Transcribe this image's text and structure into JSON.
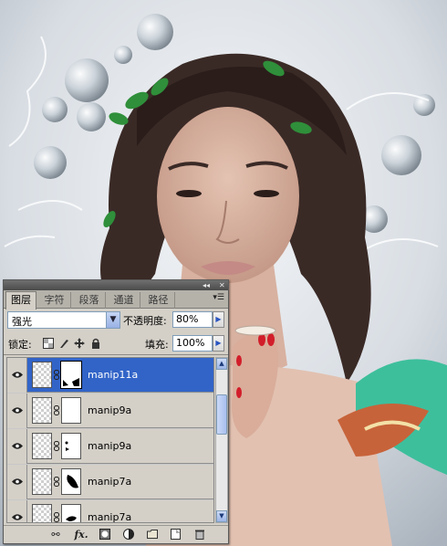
{
  "panel": {
    "title_controls": {
      "collapse": "◂◂",
      "close": "✕"
    },
    "tabs": [
      {
        "label": "图层",
        "active": true
      },
      {
        "label": "字符",
        "active": false
      },
      {
        "label": "段落",
        "active": false
      },
      {
        "label": "通道",
        "active": false
      },
      {
        "label": "路径",
        "active": false
      }
    ],
    "menu_icon": "panel-menu-icon",
    "blend_mode": "强光",
    "opacity_label": "不透明度:",
    "opacity_value": "80%",
    "lock_label": "锁定:",
    "fill_label": "填充:",
    "fill_value": "100%",
    "layers": [
      {
        "name": "manip11a",
        "visible": true,
        "selected": true
      },
      {
        "name": "manip9a",
        "visible": true,
        "selected": false
      },
      {
        "name": "manip9a",
        "visible": true,
        "selected": false
      },
      {
        "name": "manip7a",
        "visible": true,
        "selected": false
      },
      {
        "name": "manip7a",
        "visible": true,
        "selected": false
      }
    ],
    "bottom_icons": [
      "link-icon",
      "fx-icon",
      "add-mask-icon",
      "adjustment-layer-icon",
      "new-group-icon",
      "new-layer-icon",
      "trash-icon"
    ],
    "fx_label": "fx."
  },
  "colors": {
    "selection": "#3264c8",
    "panel_bg": "#d4d0c8",
    "leaves": "#2f8f3a"
  }
}
